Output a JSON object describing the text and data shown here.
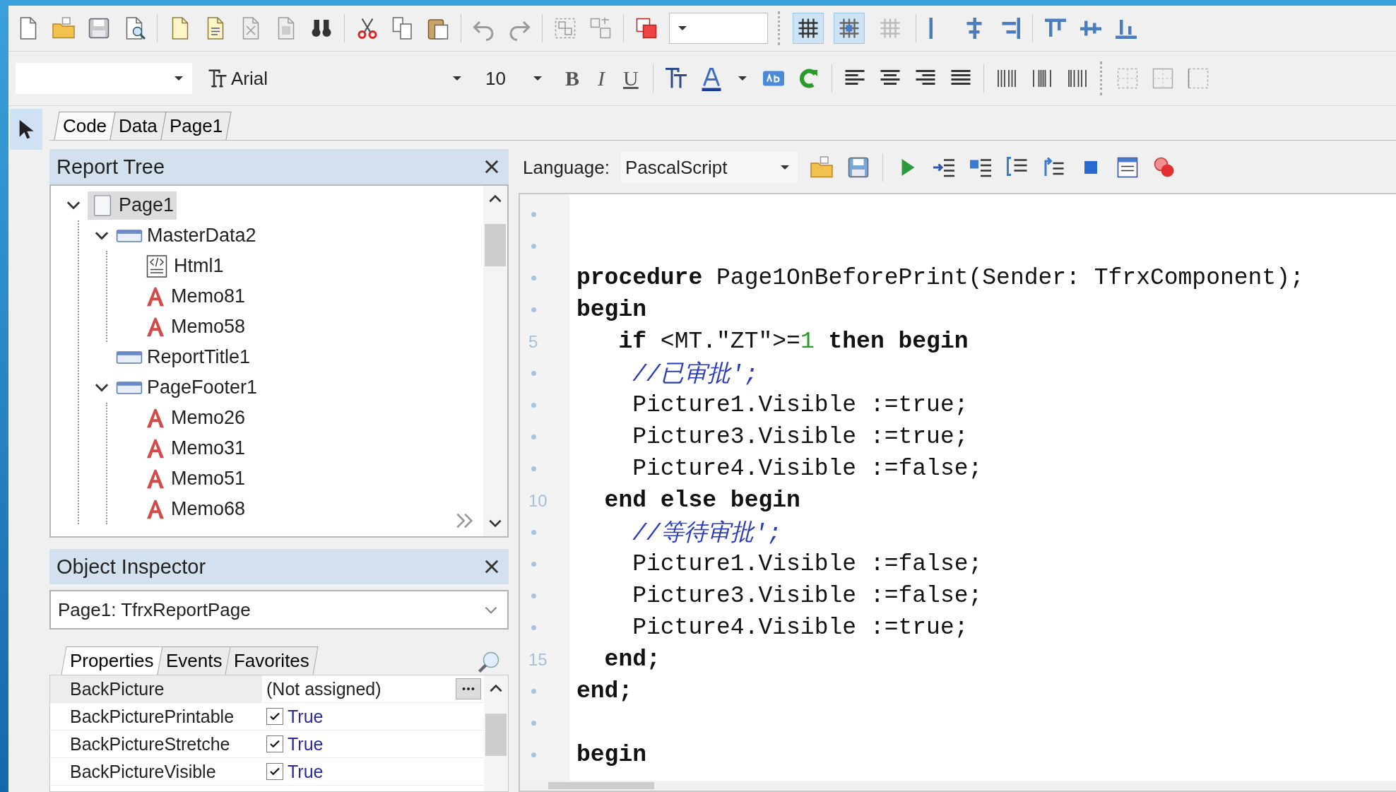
{
  "toolbar_1": {
    "toggles": [
      {
        "selected": true
      },
      {
        "selected": true
      },
      {
        "selected": false
      }
    ]
  },
  "toolbar_2": {
    "font": {
      "value": "Arial"
    },
    "size": {
      "value": "10"
    },
    "format_buttons": [
      {
        "label": "B",
        "kind": "bold"
      },
      {
        "label": "I",
        "kind": "italic"
      },
      {
        "label": "U",
        "kind": "underline"
      }
    ]
  },
  "pointer_tool": {
    "selected": true
  },
  "tabs": [
    {
      "label": "Code",
      "selected": true
    },
    {
      "label": "Data",
      "selected": false
    },
    {
      "label": "Page1",
      "selected": false
    }
  ],
  "report_tree": {
    "title": "Report Tree",
    "nodes": [
      {
        "label": "Page1",
        "kind": "page",
        "selected": true,
        "expanded": true,
        "children": [
          {
            "label": "MasterData2",
            "kind": "band",
            "selected": false,
            "expanded": true,
            "children": [
              {
                "label": "Html1",
                "kind": "html",
                "selected": false
              },
              {
                "label": "Memo81",
                "kind": "memo",
                "selected": false
              },
              {
                "label": "Memo58",
                "kind": "memo",
                "selected": false
              }
            ]
          },
          {
            "label": "ReportTitle1",
            "kind": "band",
            "selected": false
          },
          {
            "label": "PageFooter1",
            "kind": "band",
            "selected": false,
            "expanded": true,
            "children": [
              {
                "label": "Memo26",
                "kind": "memo",
                "selected": false
              },
              {
                "label": "Memo31",
                "kind": "memo",
                "selected": false
              },
              {
                "label": "Memo51",
                "kind": "memo",
                "selected": false
              },
              {
                "label": "Memo68",
                "kind": "memo",
                "selected": false
              }
            ]
          }
        ]
      }
    ]
  },
  "object_inspector": {
    "title": "Object Inspector",
    "object": "Page1: TfrxReportPage",
    "tabs": [
      {
        "label": "Properties",
        "selected": true
      },
      {
        "label": "Events",
        "selected": false
      },
      {
        "label": "Favorites",
        "selected": false
      }
    ],
    "properties": [
      {
        "name": "BackPicture",
        "kind": "text",
        "value": "(Not assigned)",
        "selected": true
      },
      {
        "name": "BackPicturePrintable",
        "kind": "boolean",
        "checked": true,
        "value": "True",
        "selected": false
      },
      {
        "name": "BackPictureStretche",
        "kind": "boolean",
        "checked": true,
        "value": "True",
        "selected": false
      },
      {
        "name": "BackPictureVisible",
        "kind": "boolean",
        "checked": true,
        "value": "True",
        "selected": false
      }
    ]
  },
  "code_editor": {
    "language_label": "Language:",
    "language": "PascalScript",
    "lines": [
      {
        "kind": "blank"
      },
      {
        "kind": "blank"
      },
      {
        "kind": "code",
        "segments": [
          {
            "kind": "keyword",
            "text": "procedure"
          },
          {
            "kind": "text",
            "text": " Page1OnBeforePrint(Sender: TfrxComponent);"
          }
        ]
      },
      {
        "kind": "code",
        "segments": [
          {
            "kind": "keyword",
            "text": "begin"
          }
        ]
      },
      {
        "kind": "code",
        "number": "5",
        "segments": [
          {
            "kind": "keyword",
            "text": "   if"
          },
          {
            "kind": "text",
            "text": " <MT.\"ZT\">="
          },
          {
            "kind": "number",
            "text": "1"
          },
          {
            "kind": "keyword",
            "text": " then begin"
          }
        ]
      },
      {
        "kind": "code",
        "segments": [
          {
            "kind": "comment",
            "text": "    //已审批';"
          }
        ]
      },
      {
        "kind": "code",
        "segments": [
          {
            "kind": "text",
            "text": "    Picture1.Visible :=true;"
          }
        ]
      },
      {
        "kind": "code",
        "segments": [
          {
            "kind": "text",
            "text": "    Picture3.Visible :=true;"
          }
        ]
      },
      {
        "kind": "code",
        "segments": [
          {
            "kind": "text",
            "text": "    Picture4.Visible :=false;"
          }
        ]
      },
      {
        "kind": "code",
        "number": "10",
        "segments": [
          {
            "kind": "keyword",
            "text": "  end else begin"
          }
        ]
      },
      {
        "kind": "code",
        "segments": [
          {
            "kind": "comment",
            "text": "    //等待审批';"
          }
        ]
      },
      {
        "kind": "code",
        "segments": [
          {
            "kind": "text",
            "text": "    Picture1.Visible :=false;"
          }
        ]
      },
      {
        "kind": "code",
        "segments": [
          {
            "kind": "text",
            "text": "    Picture3.Visible :=false;"
          }
        ]
      },
      {
        "kind": "code",
        "segments": [
          {
            "kind": "text",
            "text": "    Picture4.Visible :=true;"
          }
        ]
      },
      {
        "kind": "code",
        "number": "15",
        "segments": [
          {
            "kind": "keyword",
            "text": "  end;"
          }
        ]
      },
      {
        "kind": "code",
        "segments": [
          {
            "kind": "keyword",
            "text": "end;"
          }
        ]
      },
      {
        "kind": "blank"
      },
      {
        "kind": "code",
        "segments": [
          {
            "kind": "keyword",
            "text": "begin"
          }
        ]
      }
    ]
  }
}
